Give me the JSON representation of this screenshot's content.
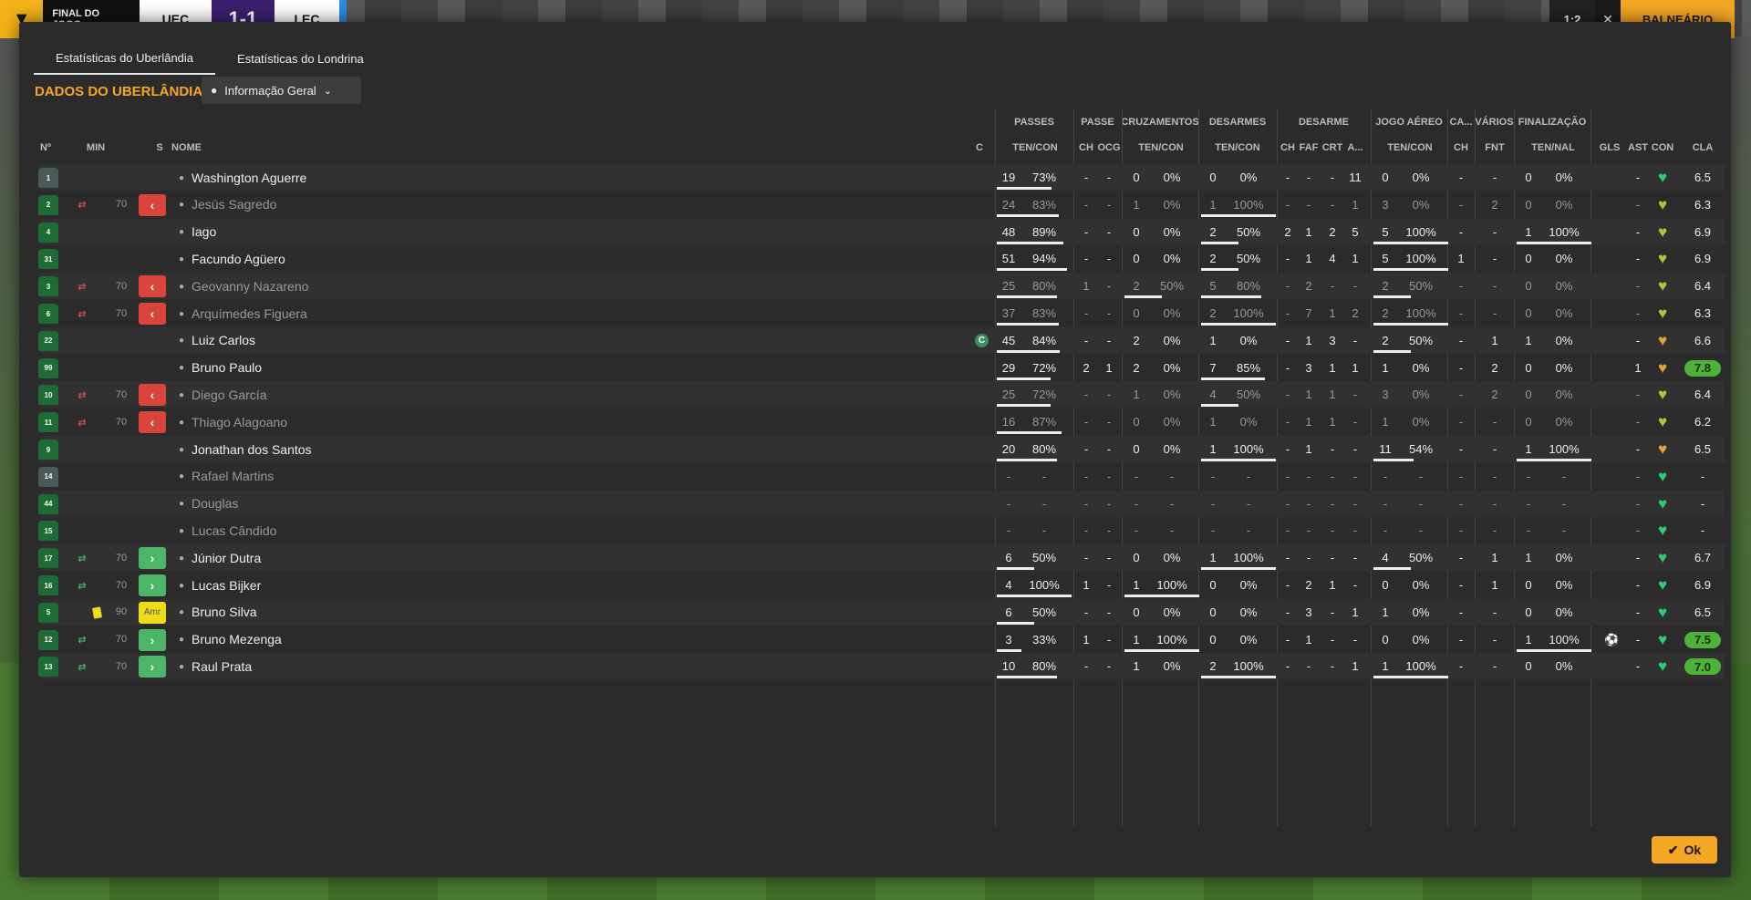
{
  "topbar": {
    "status": "FINAL DO JOGO",
    "home": "UEC",
    "score": "1-1",
    "away": "LEC",
    "timer": "1:2",
    "collapse": "✕",
    "balneario": "BALNEÁRIO"
  },
  "tabs": [
    "Estatísticas do Uberlândia",
    "Estatísticas do Londrina"
  ],
  "section_title": "DADOS DO UBERLÂNDIA",
  "view_select": "Informação Geral",
  "groups": [
    "PASSES",
    "PASSE",
    "CRUZAMENTOS",
    "DESARMES",
    "DESARME",
    "JOGO AÉREO",
    "CA...",
    "VÁRIOS",
    "FINALIZAÇÃO"
  ],
  "headers": {
    "num": "Nº",
    "min": "MIN",
    "s": "S",
    "name": "NOME",
    "c": "C",
    "passes": "TEN/CON",
    "passe_ch": "CH",
    "passe_ocg": "OCG",
    "cruz": "TEN/CON",
    "des": "TEN/CON",
    "des_ch": "CH",
    "des_faf": "FAF",
    "des_crt": "CRT",
    "des_a": "A...",
    "aereo": "TEN/CON",
    "ca_ch": "CH",
    "varios_fnt": "FNT",
    "fin": "TEN/NAL",
    "gls": "GLS",
    "ast": "AST",
    "con": "CON",
    "cla": "CLA"
  },
  "heart_colors": {
    "green": "#2ecc71",
    "yellowgreen": "#a6c93a",
    "orange": "#e0a33a"
  },
  "rows": [
    {
      "num": "1",
      "gk": true,
      "dim": false,
      "sub": "",
      "min": "",
      "sbtn": "",
      "name": "Washington Aguerre",
      "cap": false,
      "pas": [
        "19",
        "73%"
      ],
      "pb": 0.73,
      "pch": "-",
      "pocg": "-",
      "cru": [
        "0",
        "0%"
      ],
      "cb": 0,
      "des": [
        "0",
        "0%"
      ],
      "db": 0,
      "d": [
        "-",
        "-",
        "-",
        "11"
      ],
      "aer": [
        "0",
        "0%"
      ],
      "ab": 0,
      "cach": "-",
      "fnt": "-",
      "fin": [
        "0",
        "0%"
      ],
      "fb": 0,
      "gls": "",
      "ast": "-",
      "heart": "green",
      "cla": "6.5",
      "good": false
    },
    {
      "num": "2",
      "gk": false,
      "dim": true,
      "sub": "out",
      "min": "70",
      "sbtn": "out",
      "name": "Jesús Sagredo",
      "cap": false,
      "pas": [
        "24",
        "83%"
      ],
      "pb": 0.83,
      "pch": "-",
      "pocg": "-",
      "cru": [
        "1",
        "0%"
      ],
      "cb": 0,
      "des": [
        "1",
        "100%"
      ],
      "db": 1,
      "d": [
        "-",
        "-",
        "-",
        "1"
      ],
      "aer": [
        "3",
        "0%"
      ],
      "ab": 0,
      "cach": "-",
      "fnt": "2",
      "fin": [
        "0",
        "0%"
      ],
      "fb": 0,
      "gls": "",
      "ast": "-",
      "heart": "yellowgreen",
      "cla": "6.3",
      "good": false
    },
    {
      "num": "4",
      "gk": false,
      "dim": false,
      "sub": "",
      "min": "",
      "sbtn": "",
      "name": "Iago",
      "cap": false,
      "pas": [
        "48",
        "89%"
      ],
      "pb": 0.89,
      "pch": "-",
      "pocg": "-",
      "cru": [
        "0",
        "0%"
      ],
      "cb": 0,
      "des": [
        "2",
        "50%"
      ],
      "db": 0.5,
      "d": [
        "2",
        "1",
        "2",
        "5"
      ],
      "aer": [
        "5",
        "100%"
      ],
      "ab": 1,
      "cach": "-",
      "fnt": "-",
      "fin": [
        "1",
        "100%"
      ],
      "fb": 1,
      "gls": "",
      "ast": "-",
      "heart": "yellowgreen",
      "cla": "6.9",
      "good": false
    },
    {
      "num": "31",
      "gk": false,
      "dim": false,
      "sub": "",
      "min": "",
      "sbtn": "",
      "name": "Facundo Agüero",
      "cap": false,
      "pas": [
        "51",
        "94%"
      ],
      "pb": 0.94,
      "pch": "-",
      "pocg": "-",
      "cru": [
        "0",
        "0%"
      ],
      "cb": 0,
      "des": [
        "2",
        "50%"
      ],
      "db": 0.5,
      "d": [
        "-",
        "1",
        "4",
        "1"
      ],
      "aer": [
        "5",
        "100%"
      ],
      "ab": 1,
      "cach": "1",
      "fnt": "-",
      "fin": [
        "0",
        "0%"
      ],
      "fb": 0,
      "gls": "",
      "ast": "-",
      "heart": "yellowgreen",
      "cla": "6.9",
      "good": false
    },
    {
      "num": "3",
      "gk": false,
      "dim": true,
      "sub": "out",
      "min": "70",
      "sbtn": "out",
      "name": "Geovanny Nazareno",
      "cap": false,
      "pas": [
        "25",
        "80%"
      ],
      "pb": 0.8,
      "pch": "1",
      "pocg": "-",
      "cru": [
        "2",
        "50%"
      ],
      "cb": 0.5,
      "des": [
        "5",
        "80%"
      ],
      "db": 0.8,
      "d": [
        "-",
        "2",
        "-",
        "-"
      ],
      "aer": [
        "2",
        "50%"
      ],
      "ab": 0.5,
      "cach": "-",
      "fnt": "-",
      "fin": [
        "0",
        "0%"
      ],
      "fb": 0,
      "gls": "",
      "ast": "-",
      "heart": "yellowgreen",
      "cla": "6.4",
      "good": false
    },
    {
      "num": "6",
      "gk": false,
      "dim": true,
      "sub": "out",
      "min": "70",
      "sbtn": "out",
      "name": "Arquímedes Figuera",
      "cap": false,
      "pas": [
        "37",
        "83%"
      ],
      "pb": 0.83,
      "pch": "-",
      "pocg": "-",
      "cru": [
        "0",
        "0%"
      ],
      "cb": 0,
      "des": [
        "2",
        "100%"
      ],
      "db": 1,
      "d": [
        "-",
        "7",
        "1",
        "2"
      ],
      "aer": [
        "2",
        "100%"
      ],
      "ab": 1,
      "cach": "-",
      "fnt": "-",
      "fin": [
        "0",
        "0%"
      ],
      "fb": 0,
      "gls": "",
      "ast": "-",
      "heart": "yellowgreen",
      "cla": "6.3",
      "good": false
    },
    {
      "num": "22",
      "gk": false,
      "dim": false,
      "sub": "",
      "min": "",
      "sbtn": "",
      "name": "Luiz Carlos",
      "cap": true,
      "pas": [
        "45",
        "84%"
      ],
      "pb": 0.84,
      "pch": "-",
      "pocg": "-",
      "cru": [
        "2",
        "0%"
      ],
      "cb": 0,
      "des": [
        "1",
        "0%"
      ],
      "db": 0,
      "d": [
        "-",
        "1",
        "3",
        "-"
      ],
      "aer": [
        "2",
        "50%"
      ],
      "ab": 0.5,
      "cach": "-",
      "fnt": "1",
      "fin": [
        "1",
        "0%"
      ],
      "fb": 0,
      "gls": "",
      "ast": "-",
      "heart": "orange",
      "cla": "6.6",
      "good": false
    },
    {
      "num": "99",
      "gk": false,
      "dim": false,
      "sub": "",
      "min": "",
      "sbtn": "",
      "name": "Bruno Paulo",
      "cap": false,
      "pas": [
        "29",
        "72%"
      ],
      "pb": 0.72,
      "pch": "2",
      "pocg": "1",
      "cru": [
        "2",
        "0%"
      ],
      "cb": 0,
      "des": [
        "7",
        "85%"
      ],
      "db": 0.85,
      "d": [
        "-",
        "3",
        "1",
        "1"
      ],
      "aer": [
        "1",
        "0%"
      ],
      "ab": 0,
      "cach": "-",
      "fnt": "2",
      "fin": [
        "0",
        "0%"
      ],
      "fb": 0,
      "gls": "",
      "ast": "1",
      "heart": "orange",
      "cla": "7.8",
      "good": true
    },
    {
      "num": "10",
      "gk": false,
      "dim": true,
      "sub": "out",
      "min": "70",
      "sbtn": "out",
      "name": "Diego García",
      "cap": false,
      "pas": [
        "25",
        "72%"
      ],
      "pb": 0.72,
      "pch": "-",
      "pocg": "-",
      "cru": [
        "1",
        "0%"
      ],
      "cb": 0,
      "des": [
        "4",
        "50%"
      ],
      "db": 0.5,
      "d": [
        "-",
        "1",
        "1",
        "-"
      ],
      "aer": [
        "3",
        "0%"
      ],
      "ab": 0,
      "cach": "-",
      "fnt": "2",
      "fin": [
        "0",
        "0%"
      ],
      "fb": 0,
      "gls": "",
      "ast": "-",
      "heart": "yellowgreen",
      "cla": "6.4",
      "good": false
    },
    {
      "num": "11",
      "gk": false,
      "dim": true,
      "sub": "out",
      "min": "70",
      "sbtn": "out",
      "name": "Thiago Alagoano",
      "cap": false,
      "pas": [
        "16",
        "87%"
      ],
      "pb": 0.87,
      "pch": "-",
      "pocg": "-",
      "cru": [
        "0",
        "0%"
      ],
      "cb": 0,
      "des": [
        "1",
        "0%"
      ],
      "db": 0,
      "d": [
        "-",
        "1",
        "1",
        "-"
      ],
      "aer": [
        "1",
        "0%"
      ],
      "ab": 0,
      "cach": "-",
      "fnt": "-",
      "fin": [
        "0",
        "0%"
      ],
      "fb": 0,
      "gls": "",
      "ast": "-",
      "heart": "yellowgreen",
      "cla": "6.2",
      "good": false
    },
    {
      "num": "9",
      "gk": false,
      "dim": false,
      "sub": "",
      "min": "",
      "sbtn": "",
      "name": "Jonathan dos Santos",
      "cap": false,
      "pas": [
        "20",
        "80%"
      ],
      "pb": 0.8,
      "pch": "-",
      "pocg": "-",
      "cru": [
        "0",
        "0%"
      ],
      "cb": 0,
      "des": [
        "1",
        "100%"
      ],
      "db": 1,
      "d": [
        "-",
        "1",
        "-",
        "-"
      ],
      "aer": [
        "11",
        "54%"
      ],
      "ab": 0.54,
      "cach": "-",
      "fnt": "-",
      "fin": [
        "1",
        "100%"
      ],
      "fb": 1,
      "gls": "",
      "ast": "-",
      "heart": "orange",
      "cla": "6.5",
      "good": false
    },
    {
      "num": "14",
      "gk": true,
      "dim": true,
      "sub": "",
      "min": "",
      "sbtn": "",
      "name": "Rafael Martins",
      "cap": false,
      "pas": [
        "-",
        "-"
      ],
      "pb": 0,
      "pch": "-",
      "pocg": "-",
      "cru": [
        "-",
        "-"
      ],
      "cb": 0,
      "des": [
        "-",
        "-"
      ],
      "db": 0,
      "d": [
        "-",
        "-",
        "-",
        "-"
      ],
      "aer": [
        "-",
        "-"
      ],
      "ab": 0,
      "cach": "-",
      "fnt": "-",
      "fin": [
        "-",
        "-"
      ],
      "fb": 0,
      "gls": "",
      "ast": "-",
      "heart": "green",
      "cla": "-",
      "good": false
    },
    {
      "num": "44",
      "gk": false,
      "dim": true,
      "sub": "",
      "min": "",
      "sbtn": "",
      "name": "Douglas",
      "cap": false,
      "pas": [
        "-",
        "-"
      ],
      "pb": 0,
      "pch": "-",
      "pocg": "-",
      "cru": [
        "-",
        "-"
      ],
      "cb": 0,
      "des": [
        "-",
        "-"
      ],
      "db": 0,
      "d": [
        "-",
        "-",
        "-",
        "-"
      ],
      "aer": [
        "-",
        "-"
      ],
      "ab": 0,
      "cach": "-",
      "fnt": "-",
      "fin": [
        "-",
        "-"
      ],
      "fb": 0,
      "gls": "",
      "ast": "-",
      "heart": "green",
      "cla": "-",
      "good": false
    },
    {
      "num": "15",
      "gk": false,
      "dim": true,
      "sub": "",
      "min": "",
      "sbtn": "",
      "name": "Lucas Cândido",
      "cap": false,
      "pas": [
        "-",
        "-"
      ],
      "pb": 0,
      "pch": "-",
      "pocg": "-",
      "cru": [
        "-",
        "-"
      ],
      "cb": 0,
      "des": [
        "-",
        "-"
      ],
      "db": 0,
      "d": [
        "-",
        "-",
        "-",
        "-"
      ],
      "aer": [
        "-",
        "-"
      ],
      "ab": 0,
      "cach": "-",
      "fnt": "-",
      "fin": [
        "-",
        "-"
      ],
      "fb": 0,
      "gls": "",
      "ast": "-",
      "heart": "green",
      "cla": "-",
      "good": false
    },
    {
      "num": "17",
      "gk": false,
      "dim": false,
      "sub": "in",
      "min": "70",
      "sbtn": "in",
      "name": "Júnior Dutra",
      "cap": false,
      "pas": [
        "6",
        "50%"
      ],
      "pb": 0.5,
      "pch": "-",
      "pocg": "-",
      "cru": [
        "0",
        "0%"
      ],
      "cb": 0,
      "des": [
        "1",
        "100%"
      ],
      "db": 1,
      "d": [
        "-",
        "-",
        "-",
        "-"
      ],
      "aer": [
        "4",
        "50%"
      ],
      "ab": 0.5,
      "cach": "-",
      "fnt": "1",
      "fin": [
        "1",
        "0%"
      ],
      "fb": 0,
      "gls": "",
      "ast": "-",
      "heart": "green",
      "cla": "6.7",
      "good": false
    },
    {
      "num": "16",
      "gk": false,
      "dim": false,
      "sub": "in",
      "min": "70",
      "sbtn": "in",
      "name": "Lucas Bijker",
      "cap": false,
      "pas": [
        "4",
        "100%"
      ],
      "pb": 1,
      "pch": "1",
      "pocg": "-",
      "cru": [
        "1",
        "100%"
      ],
      "cb": 1,
      "des": [
        "0",
        "0%"
      ],
      "db": 0,
      "d": [
        "-",
        "2",
        "1",
        "-"
      ],
      "aer": [
        "0",
        "0%"
      ],
      "ab": 0,
      "cach": "-",
      "fnt": "1",
      "fin": [
        "0",
        "0%"
      ],
      "fb": 0,
      "gls": "",
      "ast": "-",
      "heart": "green",
      "cla": "6.9",
      "good": false
    },
    {
      "num": "5",
      "gk": false,
      "dim": false,
      "sub": "card",
      "min": "90",
      "sbtn": "card",
      "sbtn_label": "Amr",
      "name": "Bruno Silva",
      "cap": false,
      "pas": [
        "6",
        "50%"
      ],
      "pb": 0.5,
      "pch": "-",
      "pocg": "-",
      "cru": [
        "0",
        "0%"
      ],
      "cb": 0,
      "des": [
        "0",
        "0%"
      ],
      "db": 0,
      "d": [
        "-",
        "3",
        "-",
        "1"
      ],
      "aer": [
        "1",
        "0%"
      ],
      "ab": 0,
      "cach": "-",
      "fnt": "-",
      "fin": [
        "0",
        "0%"
      ],
      "fb": 0,
      "gls": "",
      "ast": "-",
      "heart": "green",
      "cla": "6.5",
      "good": false
    },
    {
      "num": "12",
      "gk": false,
      "dim": false,
      "sub": "in",
      "min": "70",
      "sbtn": "in",
      "name": "Bruno Mezenga",
      "cap": false,
      "pas": [
        "3",
        "33%"
      ],
      "pb": 0.33,
      "pch": "1",
      "pocg": "-",
      "cru": [
        "1",
        "100%"
      ],
      "cb": 1,
      "des": [
        "0",
        "0%"
      ],
      "db": 0,
      "d": [
        "-",
        "1",
        "-",
        "-"
      ],
      "aer": [
        "0",
        "0%"
      ],
      "ab": 0,
      "cach": "-",
      "fnt": "-",
      "fin": [
        "1",
        "100%"
      ],
      "fb": 1,
      "gls": "ball",
      "ast": "-",
      "heart": "green",
      "cla": "7.5",
      "good": true
    },
    {
      "num": "13",
      "gk": false,
      "dim": false,
      "sub": "in",
      "min": "70",
      "sbtn": "in",
      "name": "Raul Prata",
      "cap": false,
      "pas": [
        "10",
        "80%"
      ],
      "pb": 0.8,
      "pch": "-",
      "pocg": "-",
      "cru": [
        "1",
        "0%"
      ],
      "cb": 0,
      "des": [
        "2",
        "100%"
      ],
      "db": 1,
      "d": [
        "-",
        "-",
        "-",
        "1"
      ],
      "aer": [
        "1",
        "100%"
      ],
      "ab": 1,
      "cach": "-",
      "fnt": "-",
      "fin": [
        "0",
        "0%"
      ],
      "fb": 0,
      "gls": "",
      "ast": "-",
      "heart": "green",
      "cla": "7.0",
      "good": true
    }
  ],
  "ok_button": "Ok"
}
